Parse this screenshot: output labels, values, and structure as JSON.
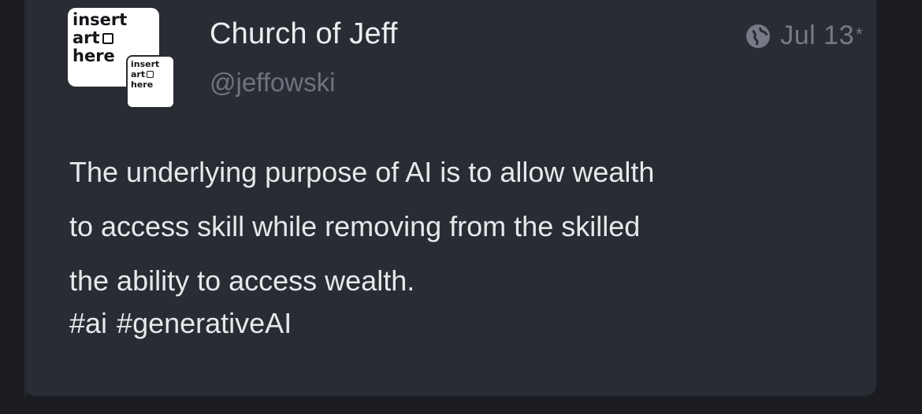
{
  "avatar": {
    "main_lines": [
      "insert",
      "art",
      "here"
    ],
    "small_lines": [
      "insert",
      "art",
      "here"
    ],
    "icon": "image-frame-icon"
  },
  "author": {
    "display_name": "Church of Jeff",
    "handle": "@jeffowski"
  },
  "meta": {
    "visibility_icon": "globe-icon",
    "date": "Jul 13",
    "more_icon": "asterisk-icon",
    "more_glyph": "*"
  },
  "post": {
    "lines": [
      "The underlying purpose of AI is to allow wealth",
      "to access skill while removing from the skilled",
      "the ability to access wealth."
    ],
    "hashtags": [
      "#ai",
      "#generativeAI"
    ]
  },
  "colors": {
    "page_background": "#1b1c22",
    "card_background": "#2a2c33",
    "text_primary": "#e6e8ec",
    "text_muted": "#6f7380"
  }
}
